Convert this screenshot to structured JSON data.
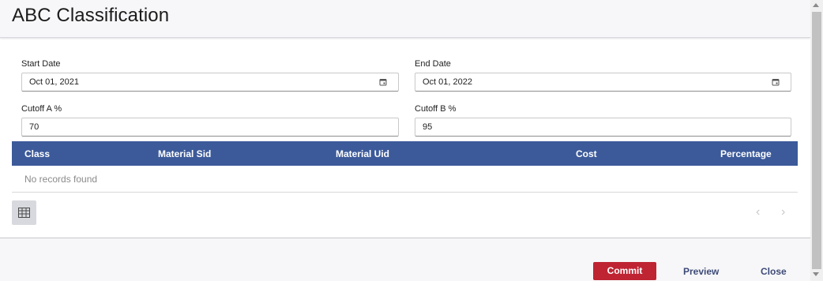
{
  "header": {
    "title": "ABC Classification"
  },
  "form": {
    "start_date": {
      "label": "Start Date",
      "value": "Oct 01, 2021",
      "icon": "calendar-icon"
    },
    "end_date": {
      "label": "End Date",
      "value": "Oct 01, 2022",
      "icon": "calendar-icon"
    },
    "cutoff_a": {
      "label": "Cutoff A %",
      "value": "70"
    },
    "cutoff_b": {
      "label": "Cutoff B %",
      "value": "95"
    }
  },
  "table": {
    "columns": [
      "Class",
      "Material Sid",
      "Material Uid",
      "Cost",
      "Percentage"
    ],
    "empty_message": "No records found",
    "header_color": "#3c5a9a"
  },
  "toolbar": {
    "grid_icon": "table-grid-icon"
  },
  "pager": {
    "prev": "‹",
    "next": "›"
  },
  "footer": {
    "commit_label": "Commit",
    "preview_label": "Preview",
    "close_label": "Close",
    "commit_color": "#bf2433"
  }
}
